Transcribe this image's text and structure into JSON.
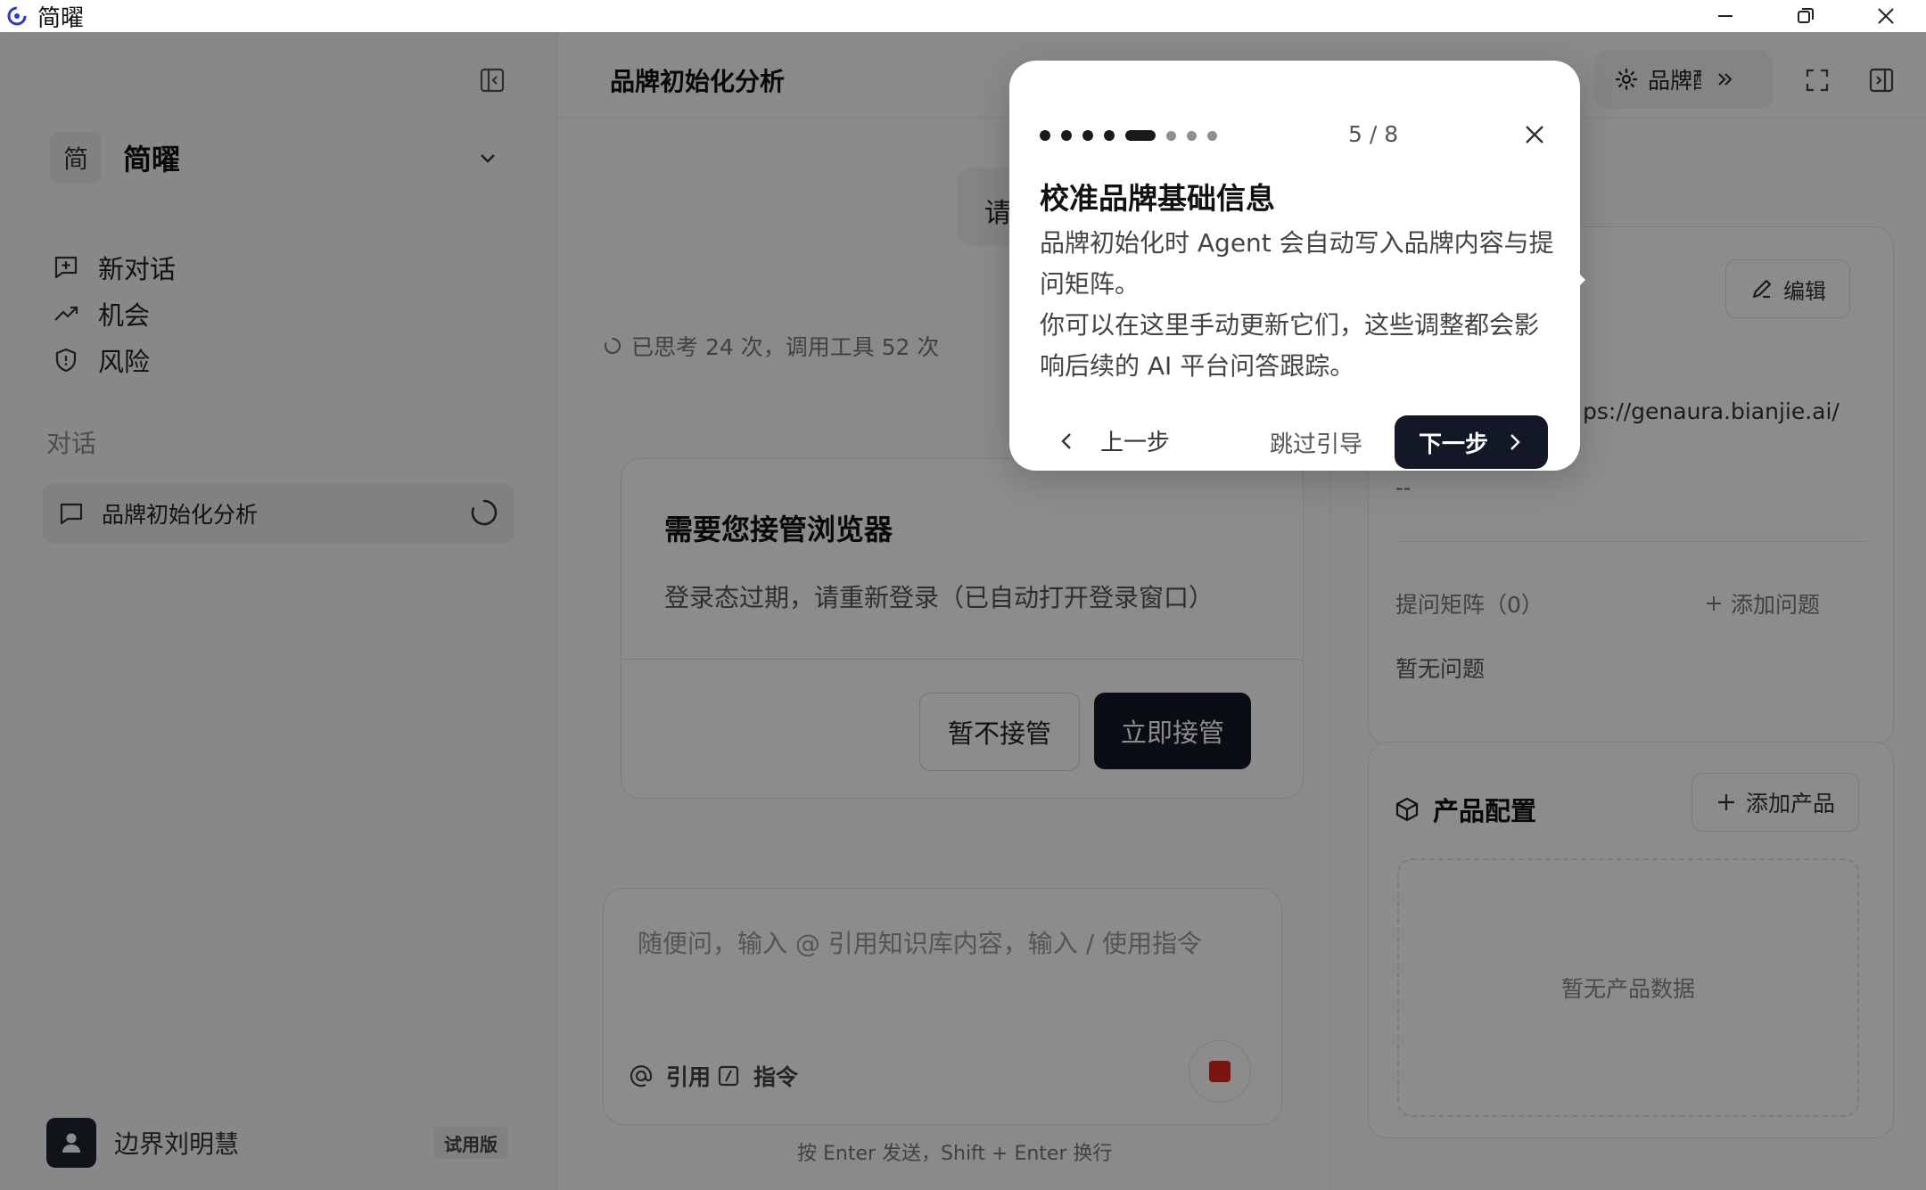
{
  "window": {
    "title": "简曜"
  },
  "sidebar": {
    "workspace": {
      "avatar": "简",
      "name": "简曜"
    },
    "nav": [
      {
        "label": "新对话",
        "icon": "new-chat-icon"
      },
      {
        "label": "机会",
        "icon": "trending-up-icon"
      },
      {
        "label": "风险",
        "icon": "shield-icon"
      }
    ],
    "section_label": "对话",
    "conversation": {
      "label": "品牌初始化分析"
    },
    "user": {
      "name": "边界刘明慧",
      "badge": "试用版"
    }
  },
  "main": {
    "title": "品牌初始化分析",
    "brand_tab_label": "品牌配置",
    "user_message": "请",
    "thinking_status": "已思考 24 次，调用工具 52 次",
    "takeover": {
      "title": "需要您接管浏览器",
      "description": "登录态过期，请重新登录（已自动打开登录窗口）",
      "decline_label": "暂不接管",
      "accept_label": "立即接管"
    },
    "composer": {
      "placeholder": "随便问，输入 @ 引用知识库内容，输入 / 使用指令",
      "cite_label": "引用",
      "command_label": "指令"
    },
    "hint": "按 Enter 发送，Shift + Enter 换行"
  },
  "right_panel": {
    "brand": {
      "edit_label": "编辑",
      "url": "ps://genaura.bianjie.ai/",
      "dash": "--",
      "question_matrix_label": "提问矩阵（0）",
      "add_question_label": "添加问题",
      "no_questions": "暂无问题"
    },
    "product": {
      "title": "产品配置",
      "add_label": "添加产品",
      "empty": "暂无产品数据"
    }
  },
  "tour": {
    "step_current": 5,
    "step_total": 8,
    "step_text": "5 / 8",
    "title": "校准品牌基础信息",
    "body_line1": "品牌初始化时 Agent 会自动写入品牌内容与提问矩阵。",
    "body_line2": "你可以在这里手动更新它们，这些调整都会影响后续的 AI 平台问答跟踪。",
    "prev_label": "上一步",
    "skip_label": "跳过引导",
    "next_label": "下一步"
  },
  "colors": {
    "primary_dark": "#131826",
    "stop_red": "#e0241c",
    "overlay": "rgba(0,0,0,0.45)"
  }
}
